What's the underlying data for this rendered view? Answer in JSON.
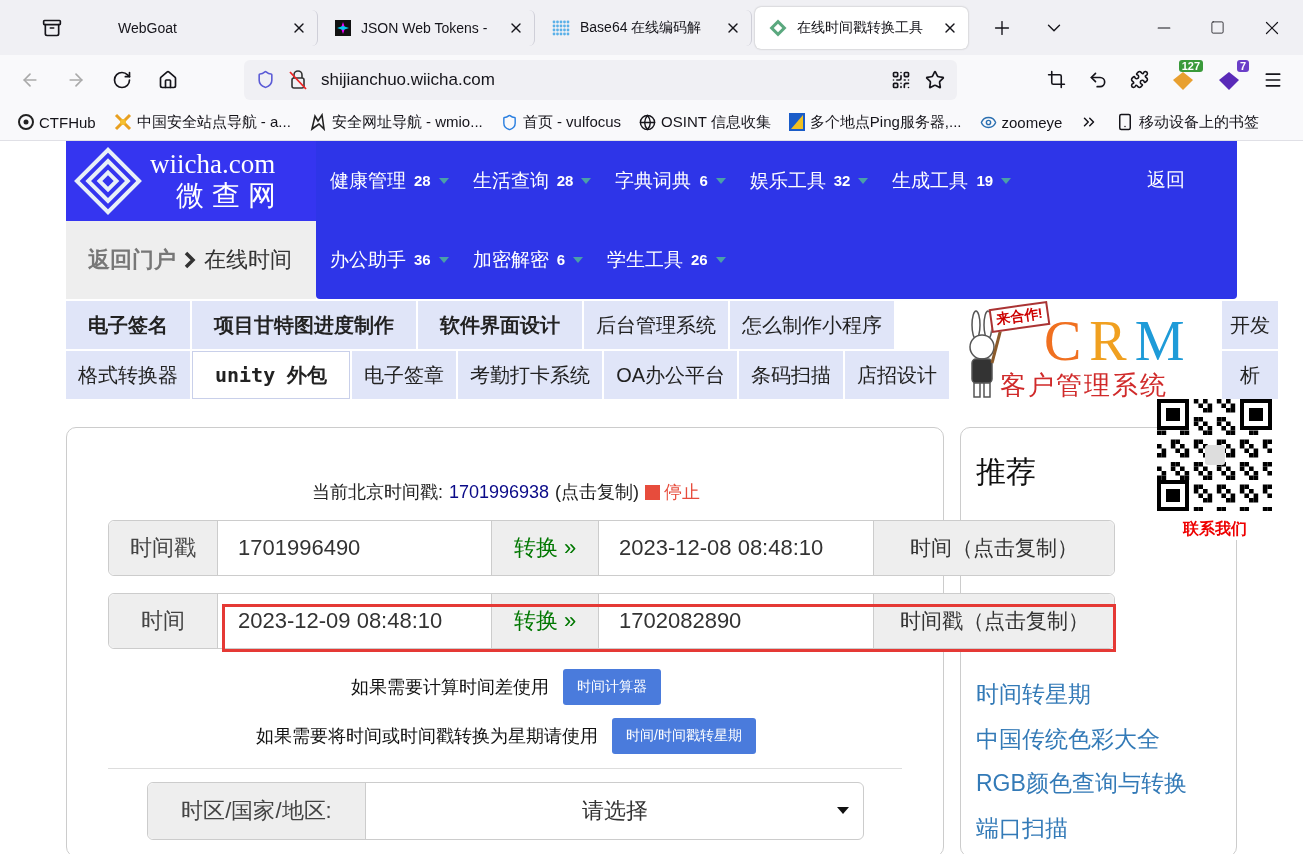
{
  "browser": {
    "tabs": [
      {
        "title": "WebGoat",
        "selected": false
      },
      {
        "title": "JSON Web Tokens -",
        "selected": false
      },
      {
        "title": "Base64 在线编码解",
        "selected": false
      },
      {
        "title": "在线时间戳转换工具",
        "selected": true
      }
    ],
    "url": "shijianchuo.wiicha.com",
    "extensions": [
      {
        "badge": "127",
        "color": "#3a9a3a"
      },
      {
        "badge": "7",
        "color": "#6b3fc8"
      }
    ],
    "bookmarks": [
      "CTFHub",
      "中国安全站点导航 - a...",
      "安全网址导航 - wmio...",
      "首页 - vulfocus",
      "OSINT 信息收集",
      "多个地点Ping服务器,...",
      "zoomeye"
    ],
    "mobile_bookmarks": "移动设备上的书签"
  },
  "site": {
    "logo": {
      "name": "wiicha.com",
      "subtitle": "微查网"
    },
    "menu": [
      [
        {
          "label": "健康管理",
          "count": "28"
        },
        {
          "label": "生活查询",
          "count": "28"
        },
        {
          "label": "字典词典",
          "count": "6"
        },
        {
          "label": "娱乐工具",
          "count": "32"
        },
        {
          "label": "生成工具",
          "count": "19"
        }
      ],
      [
        {
          "label": "办公助手",
          "count": "36"
        },
        {
          "label": "加密解密",
          "count": "6"
        },
        {
          "label": "学生工具",
          "count": "26"
        }
      ]
    ],
    "back": "返回",
    "breadcrumb": {
      "home": "返回门户",
      "current": "在线时间"
    },
    "links": [
      [
        {
          "label": "电子签名",
          "bold": true,
          "selected": false
        },
        {
          "label": "项目甘特图进度制作",
          "bold": true,
          "selected": false
        },
        {
          "label": "软件界面设计",
          "bold": true,
          "selected": false
        },
        {
          "label": "后台管理系统",
          "bold": false,
          "selected": false
        },
        {
          "label": "怎么制作小程序",
          "bold": false,
          "selected": false
        },
        {
          "label": "开发",
          "bold": false,
          "selected": false
        }
      ],
      [
        {
          "label": "格式转换器",
          "bold": false,
          "selected": false
        },
        {
          "label": "unity 外包",
          "bold": true,
          "selected": true
        },
        {
          "label": "电子签章",
          "bold": false,
          "selected": false
        },
        {
          "label": "考勤打卡系统",
          "bold": false,
          "selected": false
        },
        {
          "label": "OA办公平台",
          "bold": false,
          "selected": false
        },
        {
          "label": "条码扫描",
          "bold": false,
          "selected": false
        },
        {
          "label": "店招设计",
          "bold": false,
          "selected": false
        },
        {
          "label": "析",
          "bold": false,
          "selected": false
        }
      ]
    ],
    "ad": {
      "tag": "来合作!",
      "title": "CRM",
      "subtitle": "客户管理系统"
    },
    "contact": "联系我们"
  },
  "tool": {
    "current": {
      "label": "当前北京时间戳:",
      "value": "1701996938",
      "copy": "(点击复制)",
      "stop": "停止"
    },
    "rows": [
      {
        "label": "时间戳",
        "input": "1701996490",
        "convert": "转换 »",
        "output": "2023-12-08 08:48:10",
        "copy": "时间（点击复制）",
        "highlighted": false
      },
      {
        "label": "时间",
        "input": "2023-12-09 08:48:10",
        "convert": "转换 »",
        "output": "1702082890",
        "copy": "时间戳（点击复制）",
        "highlighted": true
      }
    ],
    "hints": [
      {
        "text": "如果需要计算时间差使用",
        "button": "时间计算器"
      },
      {
        "text": "如果需要将时间或时间戳转换为星期请使用",
        "button": "时间/时间戳转星期"
      }
    ],
    "timezone": {
      "label": "时区/国家/地区:",
      "value": "请选择"
    }
  },
  "sidebar": {
    "title": "推荐",
    "links": [
      "时间转星期",
      "中国传统色彩大全",
      "RGB颜色查询与转换",
      "端口扫描"
    ]
  }
}
